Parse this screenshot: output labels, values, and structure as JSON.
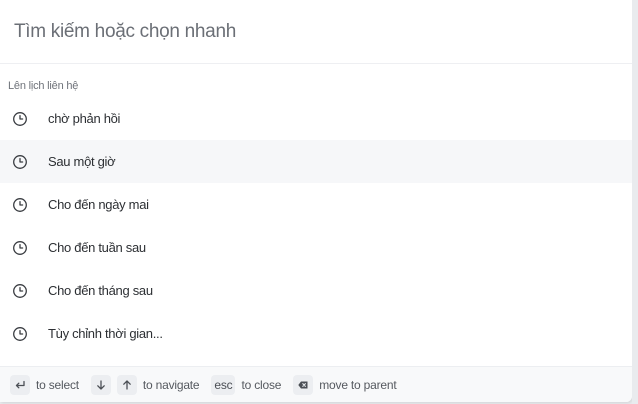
{
  "search": {
    "placeholder": "Tìm kiếm hoặc chọn nhanh",
    "value": ""
  },
  "group": {
    "label": "Lên lịch liên hệ"
  },
  "items": [
    {
      "label": "chờ phản hồi",
      "icon": "clock-icon"
    },
    {
      "label": "Sau một giờ",
      "icon": "clock-icon"
    },
    {
      "label": "Cho đến ngày mai",
      "icon": "clock-icon"
    },
    {
      "label": "Cho đến tuần sau",
      "icon": "clock-icon"
    },
    {
      "label": "Cho đến tháng sau",
      "icon": "clock-icon"
    },
    {
      "label": "Tùy chỉnh thời gian...",
      "icon": "clock-icon"
    }
  ],
  "footer": {
    "select_text": "to select",
    "navigate_text": "to navigate",
    "esc_key": "esc",
    "close_text": "to close",
    "parent_text": "move to parent"
  },
  "colors": {
    "active_row": "#f6f7f9",
    "footer_bg": "#f8f9fa",
    "text": "#2c2f33"
  }
}
